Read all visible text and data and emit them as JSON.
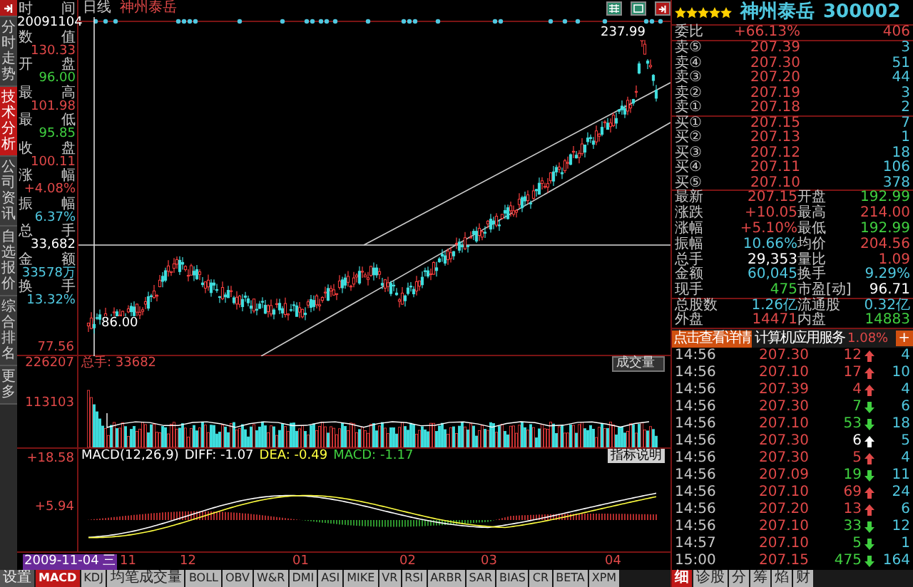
{
  "left_tabs": [
    {
      "label": "分时走势",
      "selected": false
    },
    {
      "label": "技术分析",
      "selected": true
    },
    {
      "label": "公司资讯",
      "selected": false
    },
    {
      "label": "自选报价",
      "selected": false
    },
    {
      "label": "综合排名",
      "selected": false
    },
    {
      "label": "更多",
      "selected": false
    }
  ],
  "info_panel": [
    {
      "label": "时间",
      "value": "20091104",
      "color": "#ffffff"
    },
    {
      "label": "数值",
      "value": "130.33",
      "color": "#e04848"
    },
    {
      "label": "开盘",
      "value": "96.00",
      "color": "#40d040"
    },
    {
      "label": "最高",
      "value": "101.98",
      "color": "#e04848"
    },
    {
      "label": "最低",
      "value": "95.85",
      "color": "#40d040"
    },
    {
      "label": "收盘",
      "value": "100.11",
      "color": "#e04848"
    },
    {
      "label": "涨幅",
      "value": "+4.08%",
      "color": "#e04848"
    },
    {
      "label": "振幅",
      "value": "6.37%",
      "color": "#50c8e0"
    },
    {
      "label": "总手",
      "value": "33,682",
      "color": "#ffffff"
    },
    {
      "label": "金额",
      "value": "33578万",
      "color": "#50c8e0"
    },
    {
      "label": "换手",
      "value": "13.32%",
      "color": "#50c8e0"
    }
  ],
  "axis_labels": {
    "price_low": "77.56",
    "volume_max": "226207",
    "volume_mid": "113103",
    "macd_top": "+18.58",
    "macd_mid": "+5.94"
  },
  "chart": {
    "period": "日线",
    "stock_name": "神州泰岳",
    "high_label": "237.99",
    "low_label": "86.00"
  },
  "volume_panel": {
    "label": "总手: 33682",
    "indicator": "成交量"
  },
  "macd_panel": {
    "title": "MACD(12,26,9)",
    "values": [
      {
        "label": "DIFF: -1.07",
        "color": "#ffffff"
      },
      {
        "label": "DEA: -0.49",
        "color": "#ffff40"
      },
      {
        "label": "MACD: -1.17",
        "color": "#40d040"
      }
    ],
    "help_button": "指标说明"
  },
  "date_axis": {
    "cursor_date": "2009-11-04 三",
    "months": [
      "11",
      "12",
      "01",
      "02",
      "03",
      "04"
    ]
  },
  "indicator_tabs": [
    {
      "label": "设置",
      "kind": "button",
      "selected": false
    },
    {
      "label": "MACD",
      "kind": "tab",
      "selected": true
    },
    {
      "label": "KDJ",
      "kind": "tab",
      "selected": false
    },
    {
      "label": "均笔成交量",
      "kind": "tab",
      "selected": false
    },
    {
      "label": "BOLL",
      "kind": "tab",
      "selected": false
    },
    {
      "label": "OBV",
      "kind": "tab",
      "selected": false
    },
    {
      "label": "W&R",
      "kind": "tab",
      "selected": false
    },
    {
      "label": "DMI",
      "kind": "tab",
      "selected": false
    },
    {
      "label": "ASI",
      "kind": "tab",
      "selected": false
    },
    {
      "label": "MIKE",
      "kind": "tab",
      "selected": false
    },
    {
      "label": "VR",
      "kind": "tab",
      "selected": false
    },
    {
      "label": "RSI",
      "kind": "tab",
      "selected": false
    },
    {
      "label": "ARBR",
      "kind": "tab",
      "selected": false
    },
    {
      "label": "SAR",
      "kind": "tab",
      "selected": false
    },
    {
      "label": "BIAS",
      "kind": "tab",
      "selected": false
    },
    {
      "label": "CR",
      "kind": "tab",
      "selected": false
    },
    {
      "label": "BETA",
      "kind": "tab",
      "selected": false
    },
    {
      "label": "XPM",
      "kind": "tab",
      "selected": false
    }
  ],
  "quote": {
    "stars": 5,
    "name": "神州泰岳",
    "code": "300002",
    "ratio": {
      "label": "委比",
      "percent": "+66.13%",
      "volume": "406"
    },
    "asks": [
      {
        "label": "卖⑤",
        "price": "207.39",
        "volume": "3"
      },
      {
        "label": "卖④",
        "price": "207.30",
        "volume": "51"
      },
      {
        "label": "卖③",
        "price": "207.20",
        "volume": "44"
      },
      {
        "label": "卖②",
        "price": "207.19",
        "volume": "3"
      },
      {
        "label": "卖①",
        "price": "207.18",
        "volume": "2"
      }
    ],
    "bids": [
      {
        "label": "买①",
        "price": "207.15",
        "volume": "7"
      },
      {
        "label": "买②",
        "price": "207.13",
        "volume": "1"
      },
      {
        "label": "买③",
        "price": "207.12",
        "volume": "18"
      },
      {
        "label": "买④",
        "price": "207.11",
        "volume": "106"
      },
      {
        "label": "买⑤",
        "price": "207.10",
        "volume": "378"
      }
    ],
    "stats": [
      {
        "cells": [
          {
            "label": "最新",
            "value": "207.15",
            "color": "#e04848"
          },
          {
            "label": "开盘",
            "value": "192.99",
            "color": "#40d040"
          }
        ]
      },
      {
        "cells": [
          {
            "label": "涨跌",
            "value": "+10.05",
            "color": "#e04848"
          },
          {
            "label": "最高",
            "value": "214.00",
            "color": "#e04848"
          }
        ]
      },
      {
        "cells": [
          {
            "label": "涨幅",
            "value": "+5.10%",
            "color": "#e04848"
          },
          {
            "label": "最低",
            "value": "192.99",
            "color": "#40d040"
          }
        ]
      },
      {
        "cells": [
          {
            "label": "振幅",
            "value": "10.66%",
            "color": "#50c8e0"
          },
          {
            "label": "均价",
            "value": "204.56",
            "color": "#e04848"
          }
        ]
      },
      {
        "cells": [
          {
            "label": "总手",
            "value": "29,353",
            "color": "#ffffff"
          },
          {
            "label": "量比",
            "value": "1.09",
            "color": "#e04848"
          }
        ]
      },
      {
        "cells": [
          {
            "label": "金额",
            "value": "60,045",
            "color": "#50c8e0"
          },
          {
            "label": "换手",
            "value": "9.29%",
            "color": "#50c8e0"
          }
        ]
      },
      {
        "cells": [
          {
            "label": "现手",
            "value": "475",
            "color": "#40d040"
          },
          {
            "label": "市盈[动]",
            "value": "96.71",
            "color": "#ffffff"
          }
        ]
      },
      {
        "cells": [
          {
            "label": "总股数",
            "value": "1.26亿",
            "color": "#50c8e0"
          },
          {
            "label": "流通股",
            "value": "0.32亿",
            "color": "#50c8e0"
          }
        ]
      },
      {
        "cells": [
          {
            "label": "外盘",
            "value": "14471",
            "color": "#e04848"
          },
          {
            "label": "内盘",
            "value": "14883",
            "color": "#40d040"
          }
        ]
      }
    ],
    "industry": {
      "detail_button": "点击查看详情",
      "name": "计算机应用服务",
      "change": "1.08%",
      "add_button": "+"
    },
    "trades": [
      {
        "time": "14:56",
        "price": "207.30",
        "volume": "12",
        "kind": "up",
        "color": "#e04848",
        "count": "4"
      },
      {
        "time": "14:56",
        "price": "207.10",
        "volume": "17",
        "kind": "up",
        "color": "#e04848",
        "count": "10"
      },
      {
        "time": "14:56",
        "price": "207.39",
        "volume": "4",
        "kind": "up",
        "color": "#e04848",
        "count": "4"
      },
      {
        "time": "14:56",
        "price": "207.30",
        "volume": "7",
        "kind": "down",
        "color": "#40d040",
        "count": "6"
      },
      {
        "time": "14:56",
        "price": "207.10",
        "volume": "53",
        "kind": "down",
        "color": "#40d040",
        "count": "18"
      },
      {
        "time": "14:56",
        "price": "207.30",
        "volume": "6",
        "kind": "up",
        "color": "#ffffff",
        "count": "5"
      },
      {
        "time": "14:56",
        "price": "207.30",
        "volume": "5",
        "kind": "up",
        "color": "#e04848",
        "count": "4"
      },
      {
        "time": "14:56",
        "price": "207.09",
        "volume": "19",
        "kind": "down",
        "color": "#40d040",
        "count": "11"
      },
      {
        "time": "14:56",
        "price": "207.10",
        "volume": "69",
        "kind": "up",
        "color": "#e04848",
        "count": "24"
      },
      {
        "time": "14:56",
        "price": "207.20",
        "volume": "13",
        "kind": "up",
        "color": "#e04848",
        "count": "6"
      },
      {
        "time": "14:56",
        "price": "207.10",
        "volume": "33",
        "kind": "down",
        "color": "#40d040",
        "count": "12"
      },
      {
        "time": "14:57",
        "price": "207.10",
        "volume": "5",
        "kind": "down",
        "color": "#40d040",
        "count": "1"
      },
      {
        "time": "15:00",
        "price": "207.15",
        "volume": "475",
        "kind": "down",
        "color": "#40d040",
        "count": "164"
      }
    ],
    "tabs": [
      {
        "label": "细",
        "selected": true
      },
      {
        "label": "诊股",
        "selected": false
      },
      {
        "label": "分",
        "selected": false
      },
      {
        "label": "筹",
        "selected": false
      },
      {
        "label": "焰",
        "selected": false
      },
      {
        "label": "财",
        "selected": false
      }
    ]
  }
}
